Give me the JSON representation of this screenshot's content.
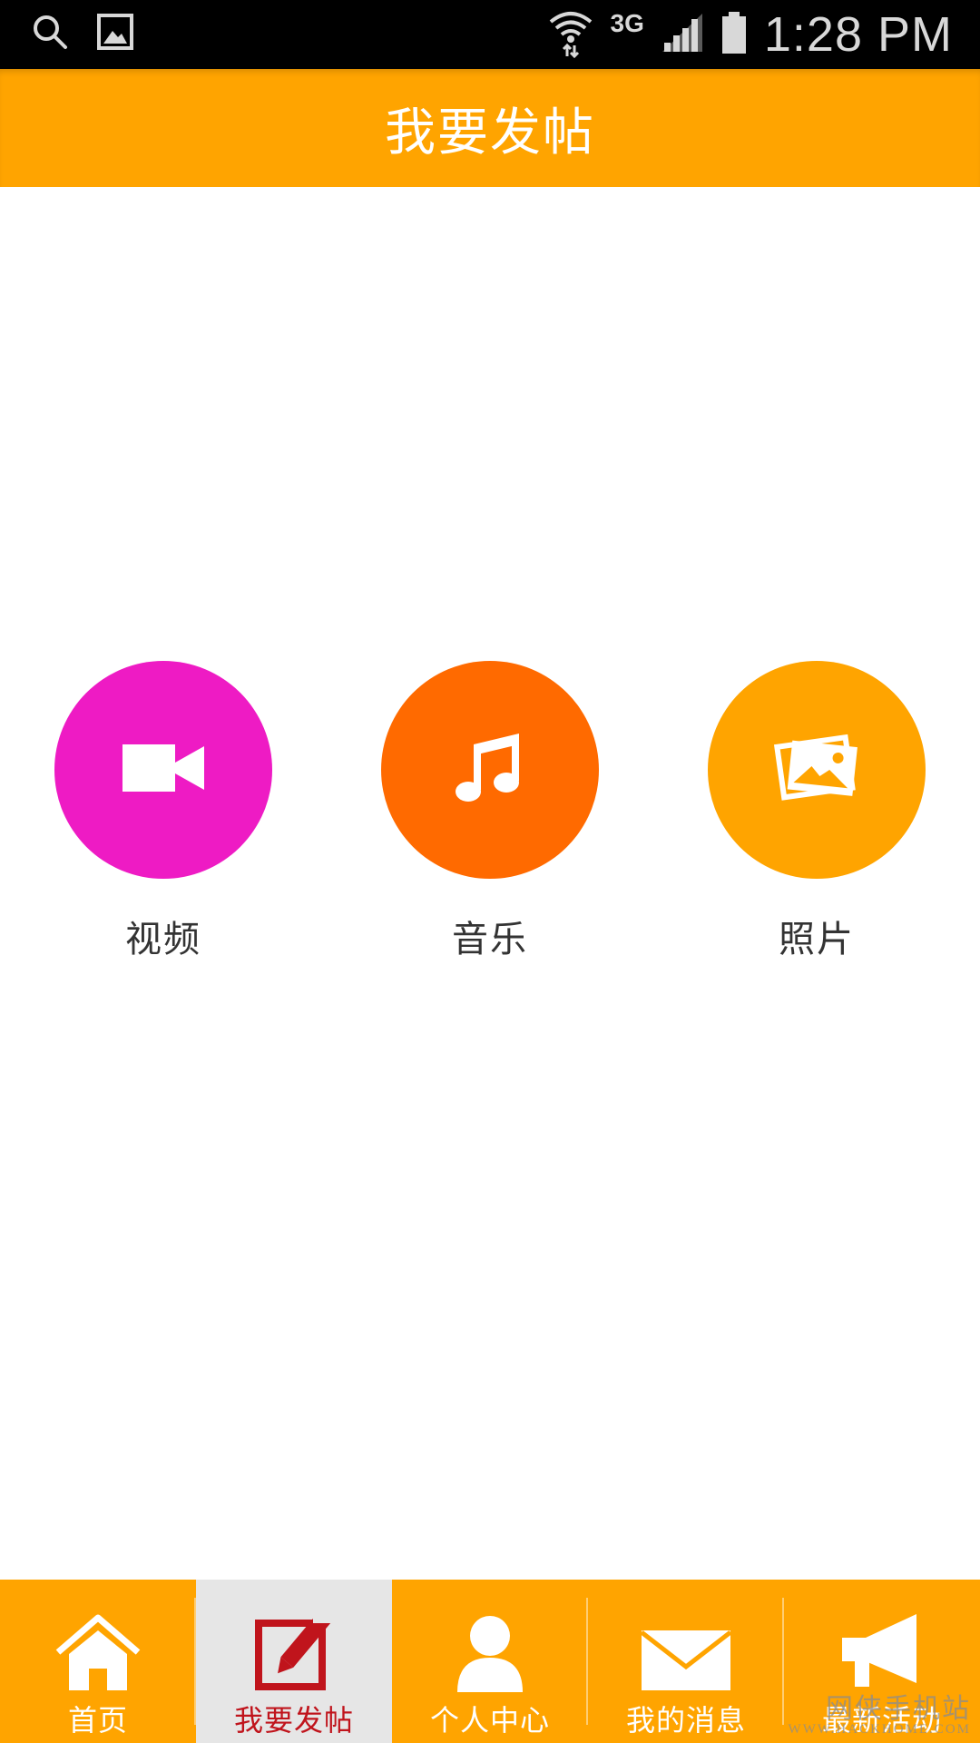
{
  "status_bar": {
    "network": "3G",
    "time": "1:28 PM"
  },
  "header": {
    "title": "我要发帖"
  },
  "post_options": [
    {
      "label": "视频",
      "icon": "video-camera-icon",
      "color": "#ee1bc4"
    },
    {
      "label": "音乐",
      "icon": "music-note-icon",
      "color": "#ff6a00"
    },
    {
      "label": "照片",
      "icon": "photos-icon",
      "color": "#ffa400"
    }
  ],
  "bottom_nav": {
    "items": [
      {
        "label": "首页",
        "icon": "home-icon",
        "active": false
      },
      {
        "label": "我要发帖",
        "icon": "edit-post-icon",
        "active": true
      },
      {
        "label": "个人中心",
        "icon": "user-icon",
        "active": false
      },
      {
        "label": "我的消息",
        "icon": "mail-icon",
        "active": false
      },
      {
        "label": "最新活动",
        "icon": "megaphone-icon",
        "active": false
      }
    ]
  },
  "watermark": {
    "text": "网侠手机站",
    "url_text": "WWW.HACKHOME.COM"
  },
  "colors": {
    "brand_orange": "#ffa400",
    "active_tab_text": "#c0141c",
    "active_tab_bg": "#e6e6e6"
  }
}
